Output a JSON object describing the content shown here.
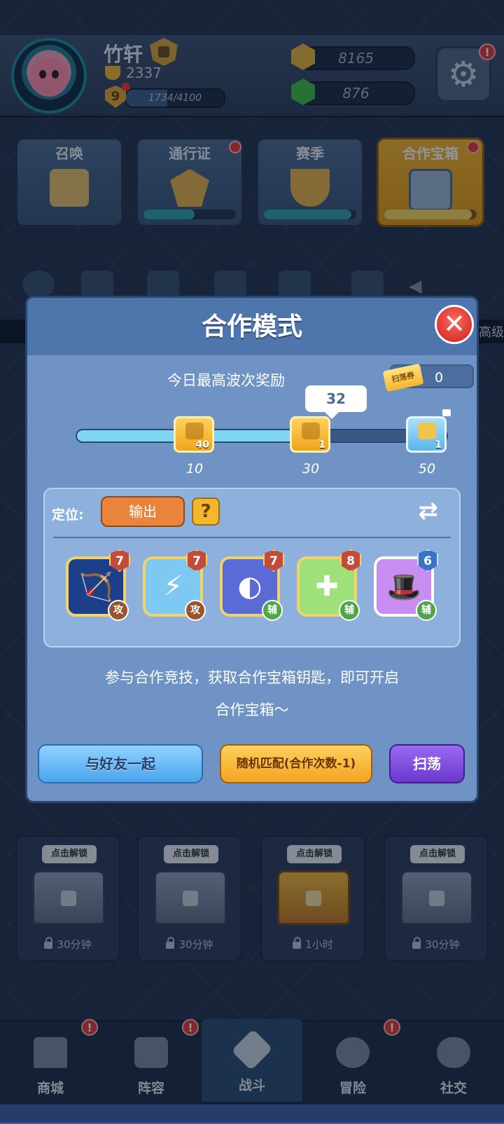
{
  "player": {
    "name": "竹轩",
    "trophies": "2337",
    "level": "9",
    "level_badge": "!",
    "xp": "1734/4100",
    "xp_progress": 0.42
  },
  "currency": {
    "coins": "8165",
    "gems": "876"
  },
  "settings_badge": "!",
  "cards": [
    {
      "title": "召唤"
    },
    {
      "title": "通行证",
      "progress": 0.55
    },
    {
      "title": "赛季",
      "progress": 0.95
    },
    {
      "title": "合作宝箱",
      "progress": 0.95
    }
  ],
  "strip_text": "高级",
  "modal": {
    "title": "合作模式",
    "close_symbol": "✕",
    "reward_title": "今日最高波次奖励",
    "sweep_ticket_label": "扫荡券",
    "sweep_ticket_count": "0",
    "current_wave": "32",
    "progress_value": 32,
    "progress_max": 50,
    "milestones": [
      {
        "wave": "10",
        "count": "40"
      },
      {
        "wave": "30",
        "count": "1"
      },
      {
        "wave": "50",
        "count": "1",
        "ticket_label": "扫荡券"
      }
    ],
    "role_label": "定位:",
    "role_value": "输出",
    "help_symbol": "?",
    "swap_symbol": "⇄",
    "heroes": [
      {
        "level": "7",
        "tag": "攻",
        "glyph": "🏹",
        "type": "attack",
        "color": "#1d3f8a"
      },
      {
        "level": "7",
        "tag": "攻",
        "glyph": "⚡",
        "type": "attack",
        "color": "#7ec9f2"
      },
      {
        "level": "7",
        "tag": "辅",
        "glyph": "◐",
        "type": "support",
        "color": "#5a6bd6"
      },
      {
        "level": "8",
        "tag": "辅",
        "glyph": "✚",
        "type": "support",
        "color": "#9ee07a"
      },
      {
        "level": "6",
        "tag": "辅",
        "glyph": "🎩",
        "type": "support",
        "color": "#c98cf0"
      }
    ],
    "description_line1": "参与合作竞技，获取合作宝箱钥匙，即可开启",
    "description_line2": "合作宝箱～",
    "btn_friend": "与好友一起",
    "btn_random": "随机匹配(合作次数-1)",
    "btn_sweep": "扫荡"
  },
  "chests": [
    {
      "tag": "点击解锁",
      "time": "30分钟",
      "type": "silver"
    },
    {
      "tag": "点击解锁",
      "time": "30分钟",
      "type": "silver"
    },
    {
      "tag": "点击解锁",
      "time": "1小时",
      "type": "gold"
    },
    {
      "tag": "点击解锁",
      "time": "30分钟",
      "type": "silver"
    }
  ],
  "nav": [
    {
      "label": "商城",
      "badge": "!"
    },
    {
      "label": "阵容",
      "badge": "!"
    },
    {
      "label": "战斗",
      "active": true
    },
    {
      "label": "冒险",
      "badge": "!"
    },
    {
      "label": "社交"
    }
  ]
}
